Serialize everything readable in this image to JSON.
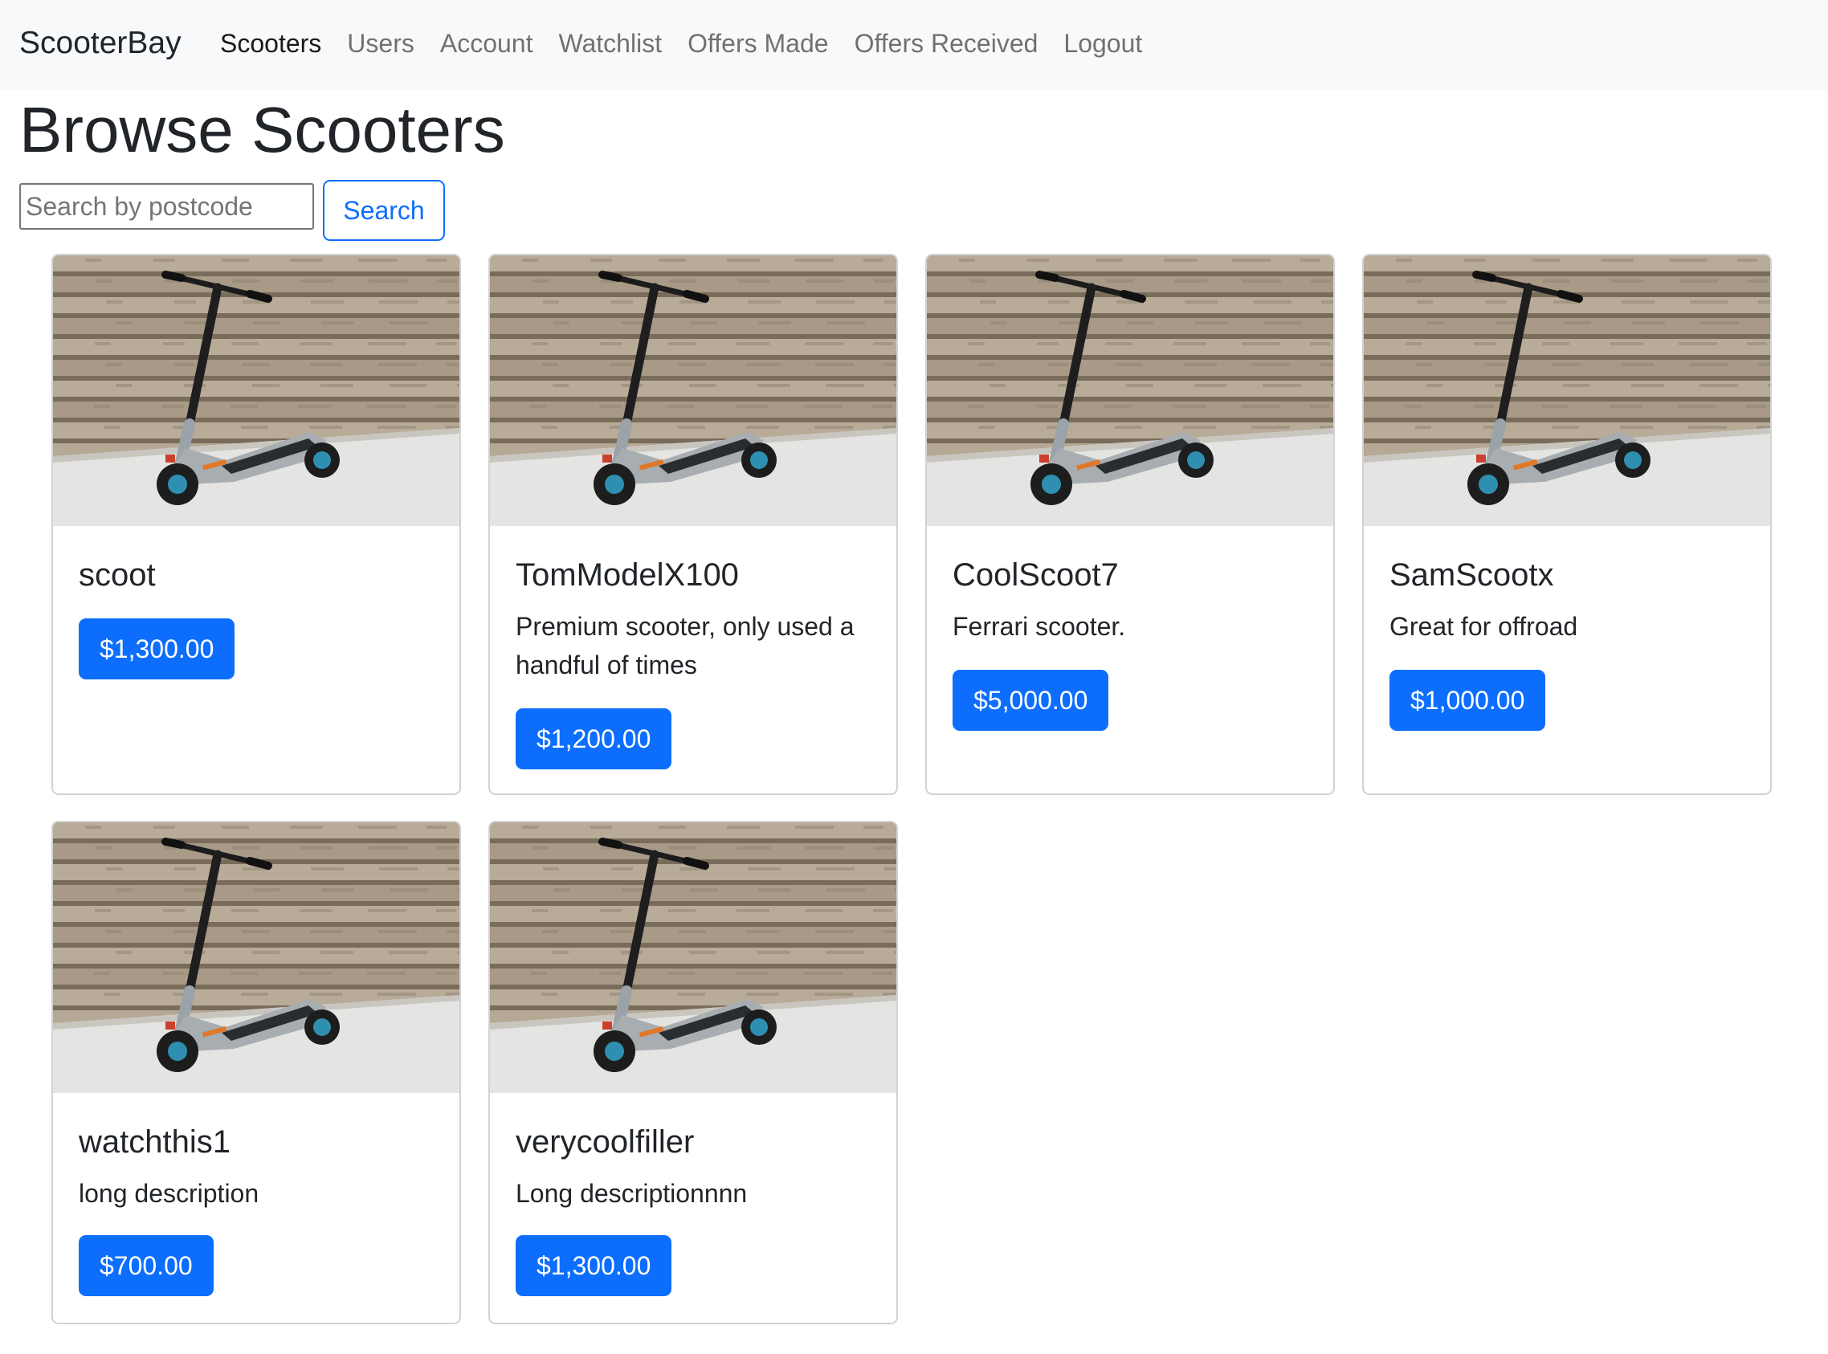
{
  "navbar": {
    "brand": "ScooterBay",
    "links": [
      "Scooters",
      "Users",
      "Account",
      "Watchlist",
      "Offers Made",
      "Offers Received",
      "Logout"
    ],
    "active": "Scooters"
  },
  "page": {
    "title": "Browse Scooters"
  },
  "search": {
    "placeholder": "Search by postcode",
    "value": "",
    "button_label": "Search"
  },
  "listings": [
    {
      "name": "scoot",
      "description": "",
      "price": "$1,300.00",
      "image": "electric-scooter-photo"
    },
    {
      "name": "TomModelX100",
      "description": "Premium scooter, only used a handful of times",
      "price": "$1,200.00",
      "image": "electric-scooter-photo"
    },
    {
      "name": "CoolScoot7",
      "description": "Ferrari scooter.",
      "price": "$5,000.00",
      "image": "electric-scooter-photo"
    },
    {
      "name": "SamScootx",
      "description": "Great for offroad",
      "price": "$1,000.00",
      "image": "electric-scooter-photo"
    },
    {
      "name": "watchthis1",
      "description": "long description",
      "price": "$700.00",
      "image": "electric-scooter-photo"
    },
    {
      "name": "verycoolfiller",
      "description": "Long descriptionnnn",
      "price": "$1,300.00",
      "image": "electric-scooter-photo"
    }
  ],
  "colors": {
    "primary": "#0d6efd",
    "navbar_bg": "#f8f9fa",
    "text": "#212529"
  }
}
